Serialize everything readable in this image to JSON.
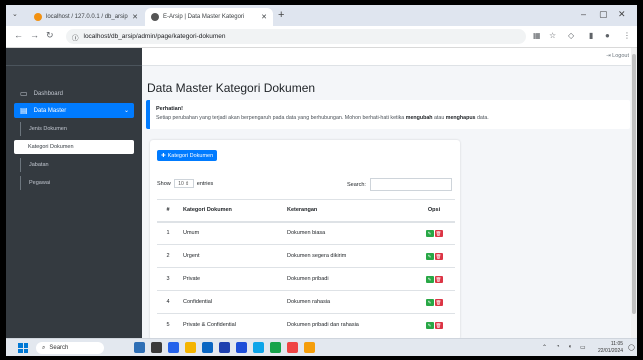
{
  "browser": {
    "tabs": [
      {
        "title": "localhost / 127.0.0.1 / db_arsip",
        "active": false
      },
      {
        "title": "E-Arsip | Data Master Kategori",
        "active": true
      }
    ],
    "url": "localhost/db_arsip/admin/page/kategori-dokumen",
    "new_tab": "+",
    "window_controls": [
      "–",
      "▢",
      "✕"
    ]
  },
  "sidebar": {
    "items": [
      {
        "label": "Dashboard",
        "icon": "desktop-icon"
      },
      {
        "label": "Data Master",
        "icon": "database-icon",
        "active": true
      }
    ],
    "subitems": [
      {
        "label": "Jenis Dokumen"
      },
      {
        "label": "Kategori Dokumen",
        "current": true
      },
      {
        "label": "Jabatan"
      },
      {
        "label": "Pegawai"
      }
    ]
  },
  "topnav": {
    "logout_label": "Logout"
  },
  "page": {
    "title": "Data Master Kategori Dokumen",
    "callout_title": "Perhatian!",
    "callout_text_1": "Setiap perubahan yang terjadi akan berpengaruh pada data yang berhubungan. Mohon berhati-hati ketika ",
    "callout_bold_1": "mengubah",
    "callout_text_2": " atau ",
    "callout_bold_2": "menghapus",
    "callout_text_3": " data."
  },
  "card": {
    "add_button": "Kategori Dokumen",
    "show_label": "Show",
    "entries_value": "10",
    "entries_label": "entries",
    "search_label": "Search:",
    "columns": [
      "#",
      "Kategori Dokumen",
      "Keterangan",
      "Opsi"
    ],
    "rows": [
      [
        "1",
        "Umum",
        "Dokumen biasa"
      ],
      [
        "2",
        "Urgent",
        "Dokumen segera dikirim"
      ],
      [
        "3",
        "Private",
        "Dokumen pribadi"
      ],
      [
        "4",
        "Confidential",
        "Dokumen rahasia"
      ],
      [
        "5",
        "Private & Confidential",
        "Dokumen pribadi dan rahasia"
      ]
    ]
  },
  "taskbar": {
    "search_label": "Search",
    "clock_time": "11:05",
    "clock_date": "22/01/2024"
  },
  "colors": {
    "primary": "#007bff",
    "sidebar": "#343a40",
    "edit": "#28a745",
    "delete": "#dc3545"
  }
}
